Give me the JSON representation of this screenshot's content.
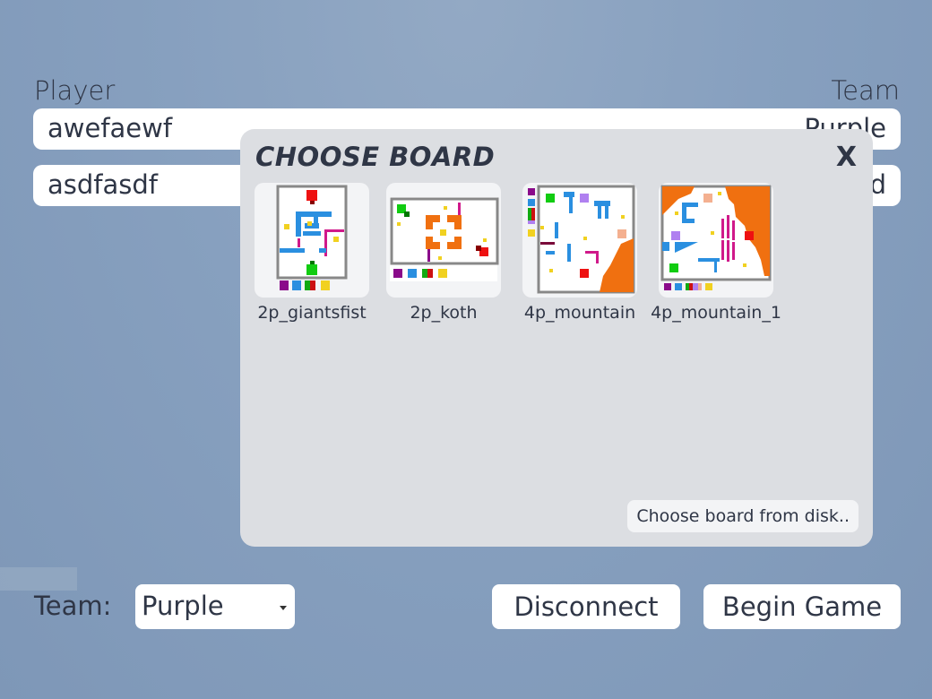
{
  "lobby": {
    "player_header": "Player",
    "team_header": "Team",
    "players": [
      {
        "name": "awefaewf",
        "team": "Purple"
      },
      {
        "name": "asdfasdf",
        "team": "Red"
      }
    ]
  },
  "footer": {
    "team_label": "Team:",
    "team_value": "Purple",
    "disconnect_label": "Disconnect",
    "begin_label": "Begin Game"
  },
  "modal": {
    "title": "CHOOSE BOARD",
    "close_label": "X",
    "boards": [
      "2p_giantsfist",
      "2p_koth",
      "4p_mountain",
      "4p_mountain_1"
    ],
    "choose_from_disk_label": "Choose board from disk.."
  }
}
